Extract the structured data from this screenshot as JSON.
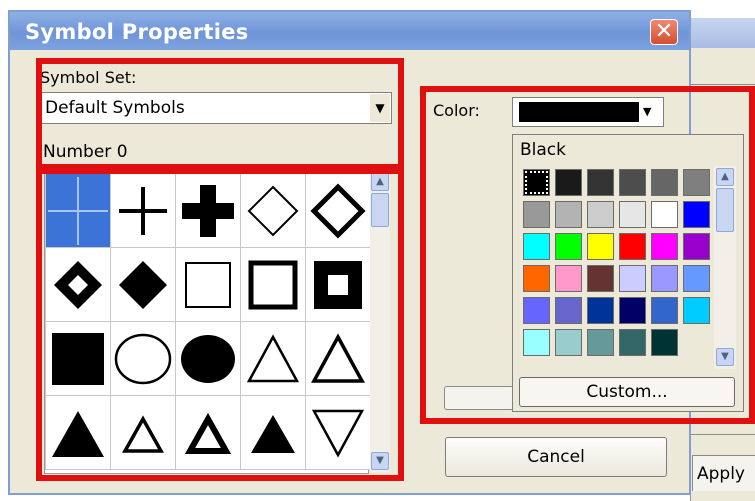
{
  "window": {
    "title": "Symbol Properties",
    "close_glyph": "✕"
  },
  "symbol_set": {
    "label": "Symbol Set:",
    "value": "Default Symbols",
    "number_label": "Number 0"
  },
  "symbols": [
    "crosshair-icon",
    "plus-icon",
    "thick-plus-icon",
    "diamond-icon",
    "bold-diamond-icon",
    "diamond-hole-icon",
    "filled-diamond-icon",
    "square-icon",
    "bold-square-icon",
    "square-hole-icon",
    "filled-square-icon",
    "circle-icon",
    "filled-circle-icon",
    "triangle-icon",
    "bold-triangle-icon",
    "filled-triangle-icon",
    "small-triangle-icon",
    "small-bold-triangle-icon",
    "small-filled-triangle-icon",
    "inverted-triangle-icon"
  ],
  "color": {
    "label": "Color:",
    "current": "#000000",
    "selected_name": "Black",
    "custom_label": "Custom...",
    "palette": [
      "#000000",
      "#1a1a1a",
      "#333333",
      "#4d4d4d",
      "#666666",
      "#7f7f7f",
      "#999999",
      "#b3b3b3",
      "#cccccc",
      "#e6e6e6",
      "#ffffff",
      "#0000ff",
      "#00ffff",
      "#00ff00",
      "#ffff00",
      "#ff0000",
      "#ff00ff",
      "#9900cc",
      "#ff6600",
      "#ff99cc",
      "#663333",
      "#ccccff",
      "#9999ff",
      "#6699ff",
      "#6666ff",
      "#6666cc",
      "#003399",
      "#000066",
      "#3366cc",
      "#00ccff",
      "#99ffff",
      "#99cccc",
      "#669999",
      "#336666",
      "#003333"
    ]
  },
  "buttons": {
    "cancel": "Cancel",
    "apply": "Apply"
  },
  "highlight_color": "#e01010"
}
